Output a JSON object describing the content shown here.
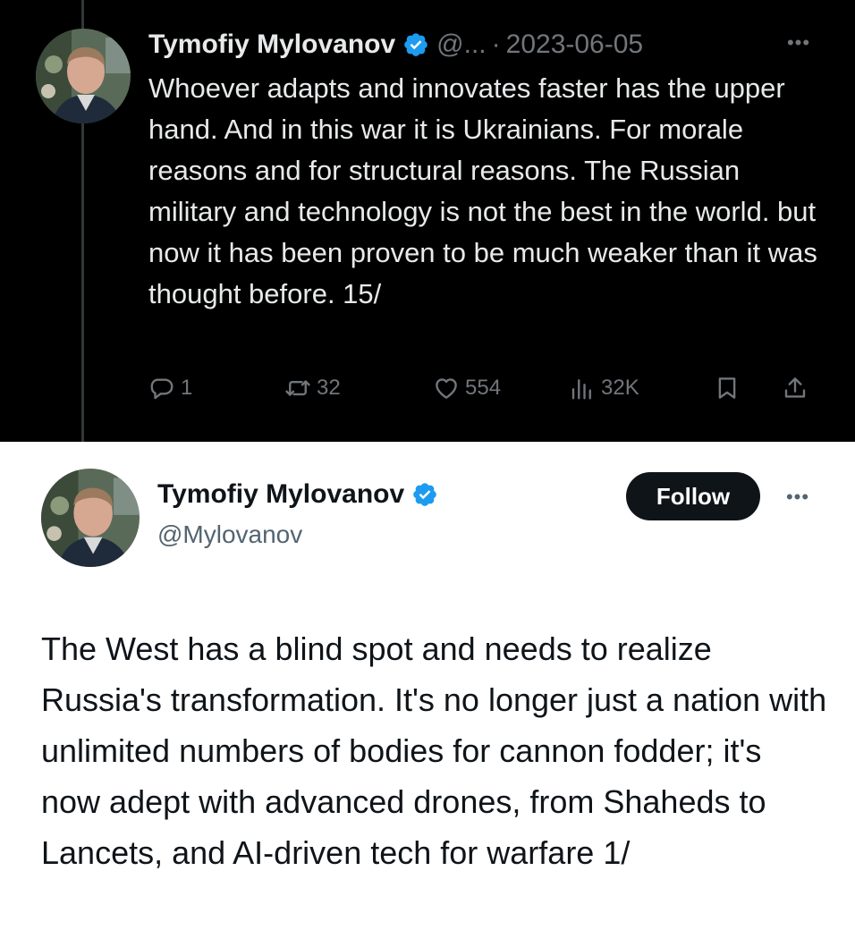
{
  "top_tweet": {
    "author_name": "Tymofiy Mylovanov",
    "handle": "@...",
    "separator": "·",
    "date": "2023-06-05",
    "more_label": "•••",
    "text": "Whoever adapts and innovates faster has the upper hand. And in this war it is Ukrainians. For morale reasons and for structural reasons. The Russian military and technology is not the best in the world. but now it has been proven to be much weaker than it was thought before. 15/",
    "replies": "1",
    "reposts": "32",
    "likes": "554",
    "views": "32K",
    "icons": [
      "reply-icon",
      "repost-icon",
      "like-icon",
      "views-icon",
      "bookmark-icon",
      "share-icon"
    ]
  },
  "bottom_tweet": {
    "author_name": "Tymofiy Mylovanov",
    "handle": "@Mylovanov",
    "follow_label": "Follow",
    "more_label": "•••",
    "text": "The West has a blind spot and needs to realize Russia's transformation. It's no longer just a nation with unlimited numbers of bodies for cannon fodder; it's now adept with advanced drones, from Shaheds to Lancets, and AI-driven tech for warfare 1/"
  },
  "colors": {
    "verified_blue": "#1d9bf0",
    "dark_bg": "#000000",
    "dark_text": "#e7e9ea",
    "muted_dark": "#71767b",
    "light_text": "#0f1419",
    "muted_light": "#536471"
  }
}
